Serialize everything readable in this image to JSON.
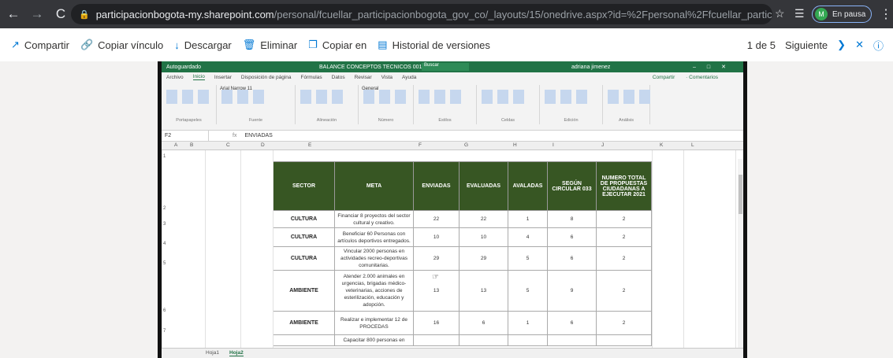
{
  "browser": {
    "back_icon": "←",
    "forward_icon": "→",
    "reload_icon": "C",
    "url_host": "participacionbogota-my.sharepoint.com",
    "url_path": "/personal/fcuellar_participacionbogota_gov_co/_layouts/15/onedrive.aspx?id=%2Fpersonal%2Ffcuellar_participacionbogot...",
    "profile_initial": "M",
    "profile_status": "En pausa"
  },
  "commandbar": {
    "share": "Compartir",
    "copy_link": "Copiar vínculo",
    "download": "Descargar",
    "delete": "Eliminar",
    "copy_to": "Copiar en",
    "version_history": "Historial de versiones",
    "pager": "1 de 5",
    "next": "Siguiente"
  },
  "excel": {
    "title_left": "Autoguardado",
    "document": "BALANCE CONCEPTOS TECNICOS 0012020",
    "search": "Buscar",
    "user": "adriana jimenez",
    "tabs": [
      "Archivo",
      "Inicio",
      "Insertar",
      "Disposición de página",
      "Fórmulas",
      "Datos",
      "Revisar",
      "Vista",
      "Ayuda"
    ],
    "active_tab": "Inicio",
    "share_right": "Compartir",
    "comments_right": "Comentarios",
    "ribbon_groups": [
      "Portapapeles",
      "Fuente",
      "Alineación",
      "Número",
      "Estilos",
      "Celdas",
      "Edición",
      "Análisis"
    ],
    "font_name": "Arial Narrow",
    "font_size": "11",
    "number_format": "General",
    "name_box": "F2",
    "formula_value": "ENVIADAS",
    "columns": [
      "A",
      "B",
      "C",
      "D",
      "E",
      "F",
      "G",
      "H",
      "I",
      "J",
      "K",
      "L"
    ],
    "rows": [
      "1",
      "2",
      "3",
      "4",
      "5",
      "6",
      "7"
    ],
    "sheets": [
      "Hoja1",
      "Hoja2"
    ],
    "active_sheet": "Hoja2"
  },
  "table": {
    "headers": [
      "SECTOR",
      "META",
      "ENVIADAS",
      "EVALUADAS",
      "AVALADAS",
      "SEGÚN CIRCULAR 033",
      "NUMERO TOTAL DE PROPUESTAS CIUDADANAS A EJECUTAR 2021"
    ],
    "rows": [
      {
        "sector": "CULTURA",
        "meta": "Financiar 8 proyectos del sector cultural y creativo.",
        "enviadas": "22",
        "evaluadas": "22",
        "avaladas": "1",
        "circular": "8",
        "total": "2"
      },
      {
        "sector": "CULTURA",
        "meta": "Beneficiar 60 Personas con artículos deportivos entregados.",
        "enviadas": "10",
        "evaluadas": "10",
        "avaladas": "4",
        "circular": "6",
        "total": "2"
      },
      {
        "sector": "CULTURA",
        "meta": "Vincular 2000 personas en actividades recreo-deportivas comunitarias.",
        "enviadas": "29",
        "evaluadas": "29",
        "avaladas": "5",
        "circular": "6",
        "total": "2"
      },
      {
        "sector": "AMBIENTE",
        "meta": "Atender 2.000 animales en urgencias, brigadas médico-veterinarias, acciones de esterilización, educación y adopción.",
        "enviadas": "13",
        "evaluadas": "13",
        "avaladas": "5",
        "circular": "9",
        "total": "2"
      },
      {
        "sector": "AMBIENTE",
        "meta": "Realizar e implementar 12 de PROCEDAS",
        "enviadas": "16",
        "evaluadas": "6",
        "avaladas": "1",
        "circular": "6",
        "total": "2"
      },
      {
        "sector": "",
        "meta": "Capacitar 800 personas en",
        "enviadas": "",
        "evaluadas": "",
        "avaladas": "",
        "circular": "",
        "total": ""
      }
    ]
  },
  "colors": {
    "header_green": "#375623",
    "excel_green": "#217346",
    "onedrive_blue": "#0078d4"
  }
}
